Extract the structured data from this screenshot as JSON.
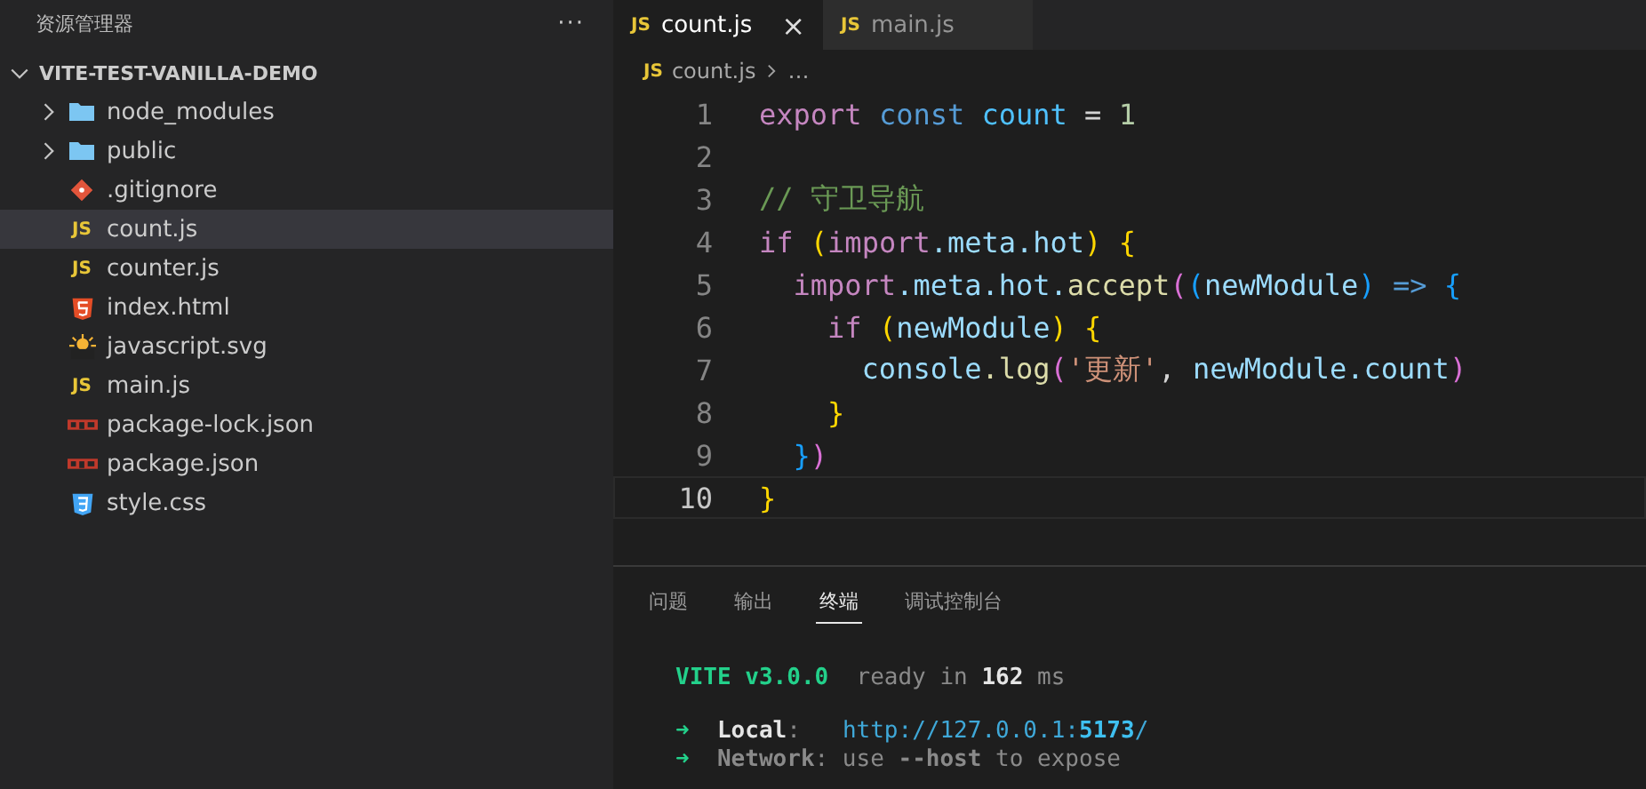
{
  "sidebar": {
    "title": "资源管理器",
    "more": "···",
    "tree": [
      {
        "label": "VITE-TEST-VANILLA-DEMO",
        "expanded": true,
        "selected": false,
        "children": [
          {
            "label": "node_modules",
            "kind": "folder",
            "expanded": false,
            "selected": false
          },
          {
            "label": "public",
            "kind": "folder",
            "expanded": false,
            "selected": false
          },
          {
            "label": ".gitignore",
            "kind": "git",
            "selected": false
          },
          {
            "label": "count.js",
            "kind": "js",
            "badge": "JS",
            "selected": true
          },
          {
            "label": "counter.js",
            "kind": "js",
            "badge": "JS",
            "selected": false
          },
          {
            "label": "index.html",
            "kind": "html",
            "selected": false
          },
          {
            "label": "javascript.svg",
            "kind": "svg",
            "selected": false
          },
          {
            "label": "main.js",
            "kind": "js",
            "badge": "JS",
            "selected": false
          },
          {
            "label": "package-lock.json",
            "kind": "npm",
            "selected": false
          },
          {
            "label": "package.json",
            "kind": "npm",
            "selected": false
          },
          {
            "label": "style.css",
            "kind": "css",
            "selected": false
          }
        ]
      }
    ]
  },
  "editor_tabs": [
    {
      "label": "count.js",
      "badge": "JS",
      "selected": true,
      "close": "×"
    },
    {
      "label": "main.js",
      "badge": "JS",
      "selected": false
    }
  ],
  "breadcrumb": {
    "badge": "JS",
    "items": [
      "count.js",
      "…"
    ]
  },
  "code_lines": [
    {
      "number": "1",
      "current": false,
      "tokens": [
        {
          "text": "export ",
          "kind": "keyword"
        },
        {
          "text": "const ",
          "kind": "storage"
        },
        {
          "text": "count",
          "kind": "constant"
        },
        {
          "text": " = ",
          "kind": "plain"
        },
        {
          "text": "1",
          "kind": "number"
        }
      ]
    },
    {
      "number": "2",
      "current": false
    },
    {
      "number": "3",
      "current": false,
      "tokens": [
        {
          "text": "// 守卫导航",
          "kind": "comment"
        }
      ]
    },
    {
      "number": "4",
      "current": false,
      "tokens": [
        {
          "text": "if ",
          "kind": "keyword"
        },
        {
          "text": "(",
          "kind": "bracket1"
        },
        {
          "text": "import",
          "kind": "keyword"
        },
        {
          "text": ".meta.hot",
          "kind": "variable"
        },
        {
          "text": ") {",
          "kind": "bracket1"
        }
      ]
    },
    {
      "number": "5",
      "current": false,
      "tokens": [
        {
          "text": "  import",
          "kind": "keyword"
        },
        {
          "text": ".meta.hot.",
          "kind": "variable"
        },
        {
          "text": "accept",
          "kind": "function"
        },
        {
          "text": "(",
          "kind": "bracket2"
        },
        {
          "text": "(",
          "kind": "bracket3"
        },
        {
          "text": "newModule",
          "kind": "variable"
        },
        {
          "text": ")",
          "kind": "bracket3"
        },
        {
          "text": " => ",
          "kind": "storage"
        },
        {
          "text": "{",
          "kind": "bracket3"
        }
      ]
    },
    {
      "number": "6",
      "current": false,
      "tokens": [
        {
          "text": "    if ",
          "kind": "keyword"
        },
        {
          "text": "(",
          "kind": "bracket1"
        },
        {
          "text": "newModule",
          "kind": "variable"
        },
        {
          "text": ") {",
          "kind": "bracket1"
        }
      ]
    },
    {
      "number": "7",
      "current": false,
      "tokens": [
        {
          "text": "      console",
          "kind": "variable"
        },
        {
          "text": ".log",
          "kind": "function"
        },
        {
          "text": "(",
          "kind": "bracket2"
        },
        {
          "text": "'更新'",
          "kind": "string"
        },
        {
          "text": ", ",
          "kind": "plain"
        },
        {
          "text": "newModule.count",
          "kind": "variable"
        },
        {
          "text": ")",
          "kind": "bracket2"
        }
      ]
    },
    {
      "number": "8",
      "current": false,
      "tokens": [
        {
          "text": "    }",
          "kind": "bracket1"
        }
      ]
    },
    {
      "number": "9",
      "current": false,
      "tokens": [
        {
          "text": "  }",
          "kind": "bracket3"
        },
        {
          "text": ")",
          "kind": "bracket2"
        }
      ]
    },
    {
      "number": "10",
      "current": true,
      "tokens": [
        {
          "text": "}",
          "kind": "bracket1"
        }
      ]
    }
  ],
  "panel_tabs": [
    {
      "label": "问题",
      "selected": false
    },
    {
      "label": "输出",
      "selected": false
    },
    {
      "label": "终端",
      "selected": true
    },
    {
      "label": "调试控制台",
      "selected": false
    }
  ],
  "terminal_lines": [
    {
      "tokens": [
        {
          "text": "VITE v3.0.0",
          "kind": "green-bold"
        },
        {
          "text": "  ready in ",
          "kind": "dim"
        },
        {
          "text": "162",
          "kind": "bold"
        },
        {
          "text": " ms",
          "kind": "dim"
        }
      ]
    },
    {
      "tokens": [
        {
          "text": "➜",
          "kind": "green"
        },
        {
          "text": "  Local",
          "kind": "bold"
        },
        {
          "text": ":   ",
          "kind": "dim"
        },
        {
          "text": "http://127.0.0.1:",
          "kind": "cyan"
        },
        {
          "text": "5173",
          "kind": "cyan-bold"
        },
        {
          "text": "/",
          "kind": "cyan"
        }
      ]
    },
    {
      "tokens": [
        {
          "text": "➜",
          "kind": "green"
        },
        {
          "text": "  Network",
          "kind": "dim-bold"
        },
        {
          "text": ": use ",
          "kind": "dim"
        },
        {
          "text": "--host",
          "kind": "dim-bold"
        },
        {
          "text": " to expose",
          "kind": "dim"
        }
      ]
    }
  ]
}
